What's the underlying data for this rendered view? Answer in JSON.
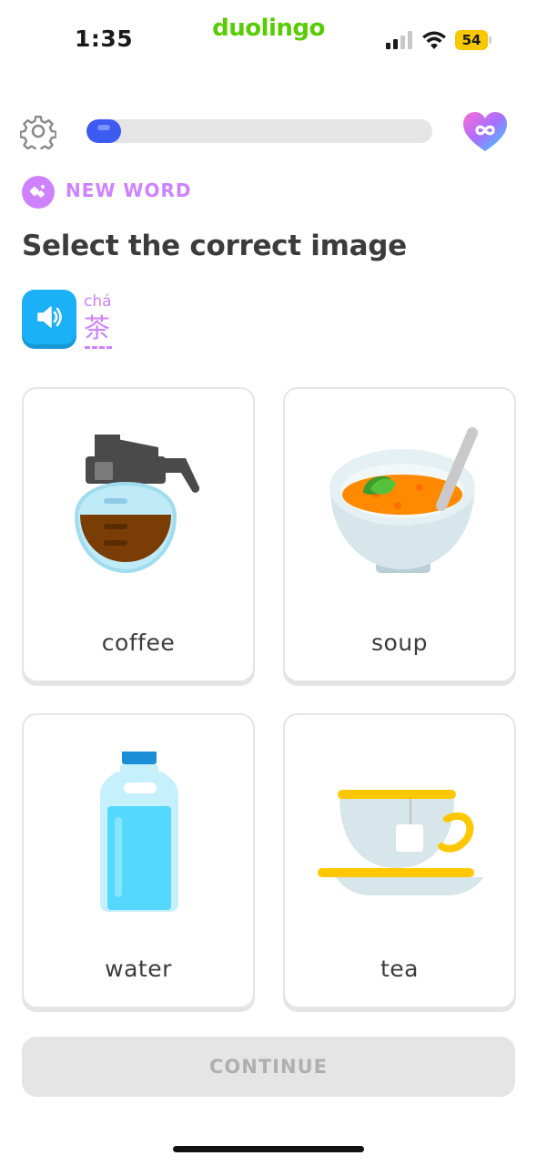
{
  "status_bar": {
    "time": "1:35",
    "app_name": "duolingo",
    "battery": "54",
    "icons": [
      "signal-icon",
      "wifi-icon",
      "battery-icon"
    ]
  },
  "header": {
    "progress": 0.1,
    "icons": [
      "settings-gear-icon",
      "infinity-heart-icon"
    ]
  },
  "badge": {
    "label": "NEW WORD",
    "icon": "new-word-icon"
  },
  "prompt": {
    "title": "Select the correct image",
    "pinyin": "chá",
    "hanzi": "茶",
    "icon": "speaker-icon"
  },
  "options": [
    {
      "label": "coffee",
      "icon": "coffee-pot-icon"
    },
    {
      "label": "soup",
      "icon": "soup-bowl-icon"
    },
    {
      "label": "water",
      "icon": "water-bottle-icon"
    },
    {
      "label": "tea",
      "icon": "tea-cup-icon"
    }
  ],
  "footer": {
    "continue_label": "CONTINUE"
  },
  "colors": {
    "brand_green": "#58cc02",
    "progress_blue": "#3d5af1",
    "new_word_purple": "#ce82ff",
    "speaker_blue": "#1cb0f6",
    "disabled_gray": "#e5e5e5"
  }
}
